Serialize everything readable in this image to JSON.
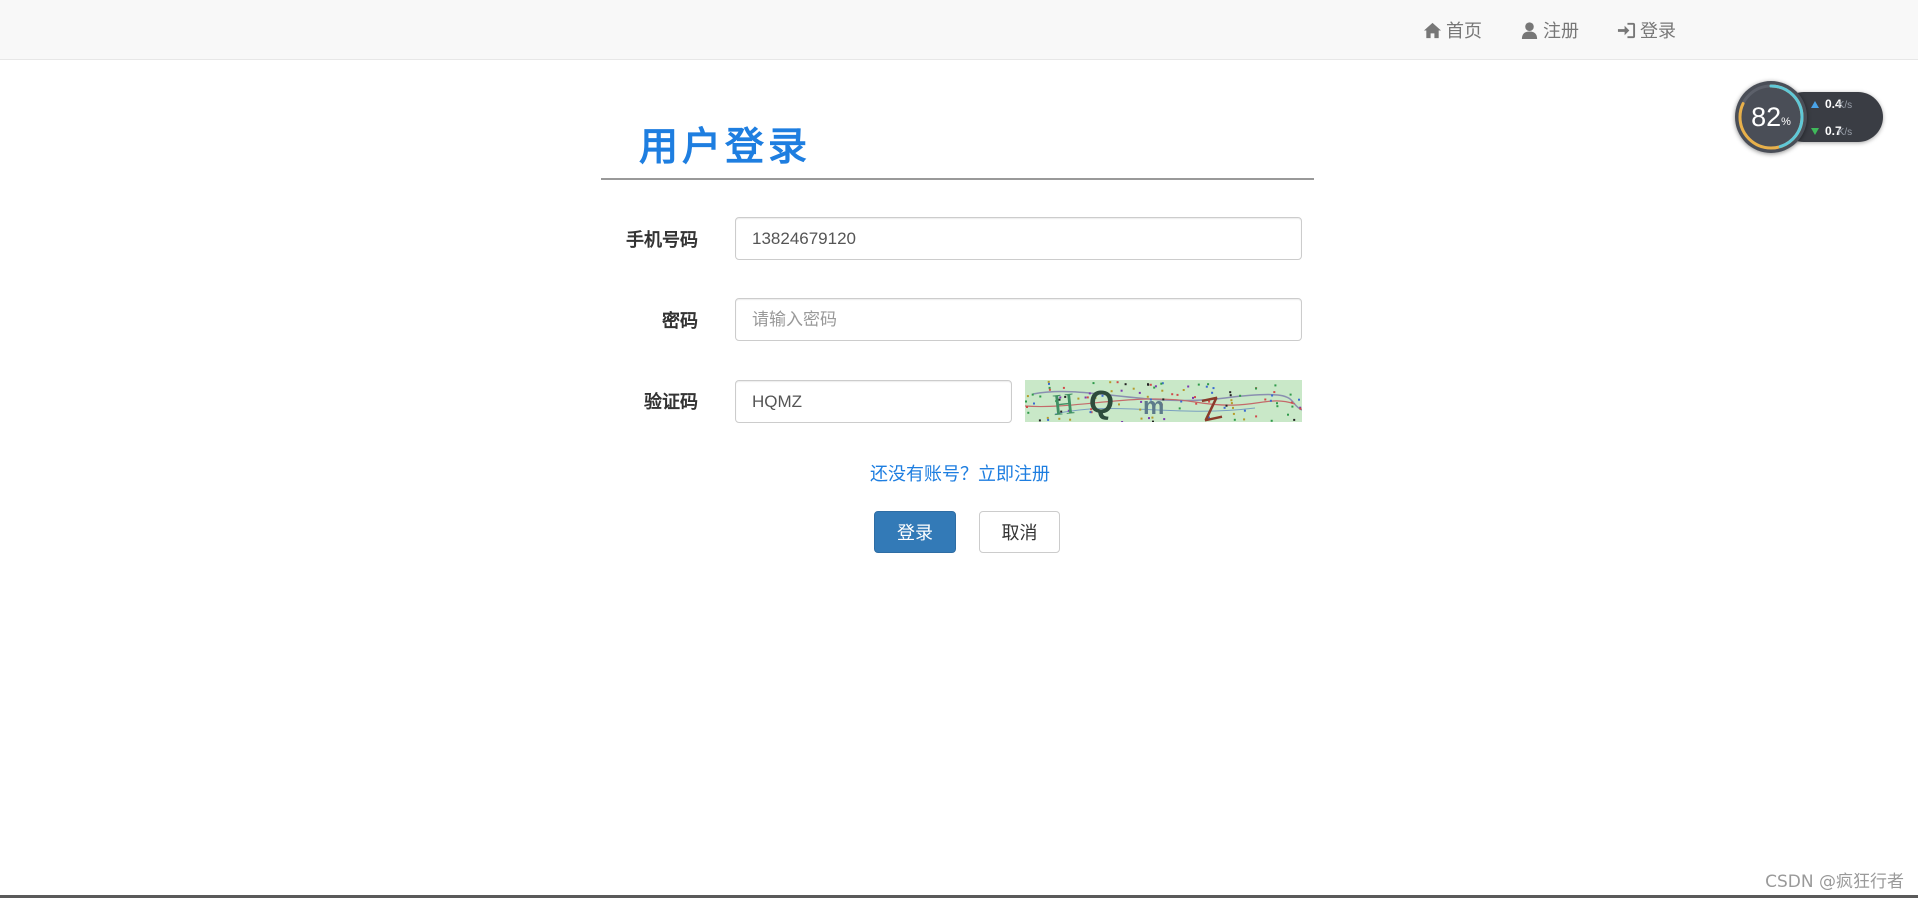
{
  "nav": {
    "home": {
      "icon": "home-icon",
      "label": "首页"
    },
    "register": {
      "icon": "user-icon",
      "label": "注册"
    },
    "login": {
      "icon": "sign-in-icon",
      "label": "登录"
    }
  },
  "speed_widget": {
    "percent": "82",
    "percent_unit": "%",
    "percent_value": 82,
    "upload": {
      "value": "0.4",
      "unit": "K/s"
    },
    "download": {
      "value": "0.7",
      "unit": "K/s"
    }
  },
  "form": {
    "title": "用户登录",
    "phone": {
      "label": "手机号码",
      "value": "13824679120",
      "placeholder": ""
    },
    "password": {
      "label": "密码",
      "value": "",
      "placeholder": "请输入密码"
    },
    "captcha": {
      "label": "验证码",
      "value": "HQMZ",
      "image_text": "HQmZ"
    },
    "register_link": "还没有账号？立即注册",
    "submit_label": "登录",
    "cancel_label": "取消"
  },
  "watermark": "CSDN @疯狂行者",
  "colors": {
    "accent": "#1e7ee0",
    "primary_button": "#337ab7",
    "navbar_bg": "#f8f8f8",
    "captcha_bg": "#c9e8c8"
  }
}
